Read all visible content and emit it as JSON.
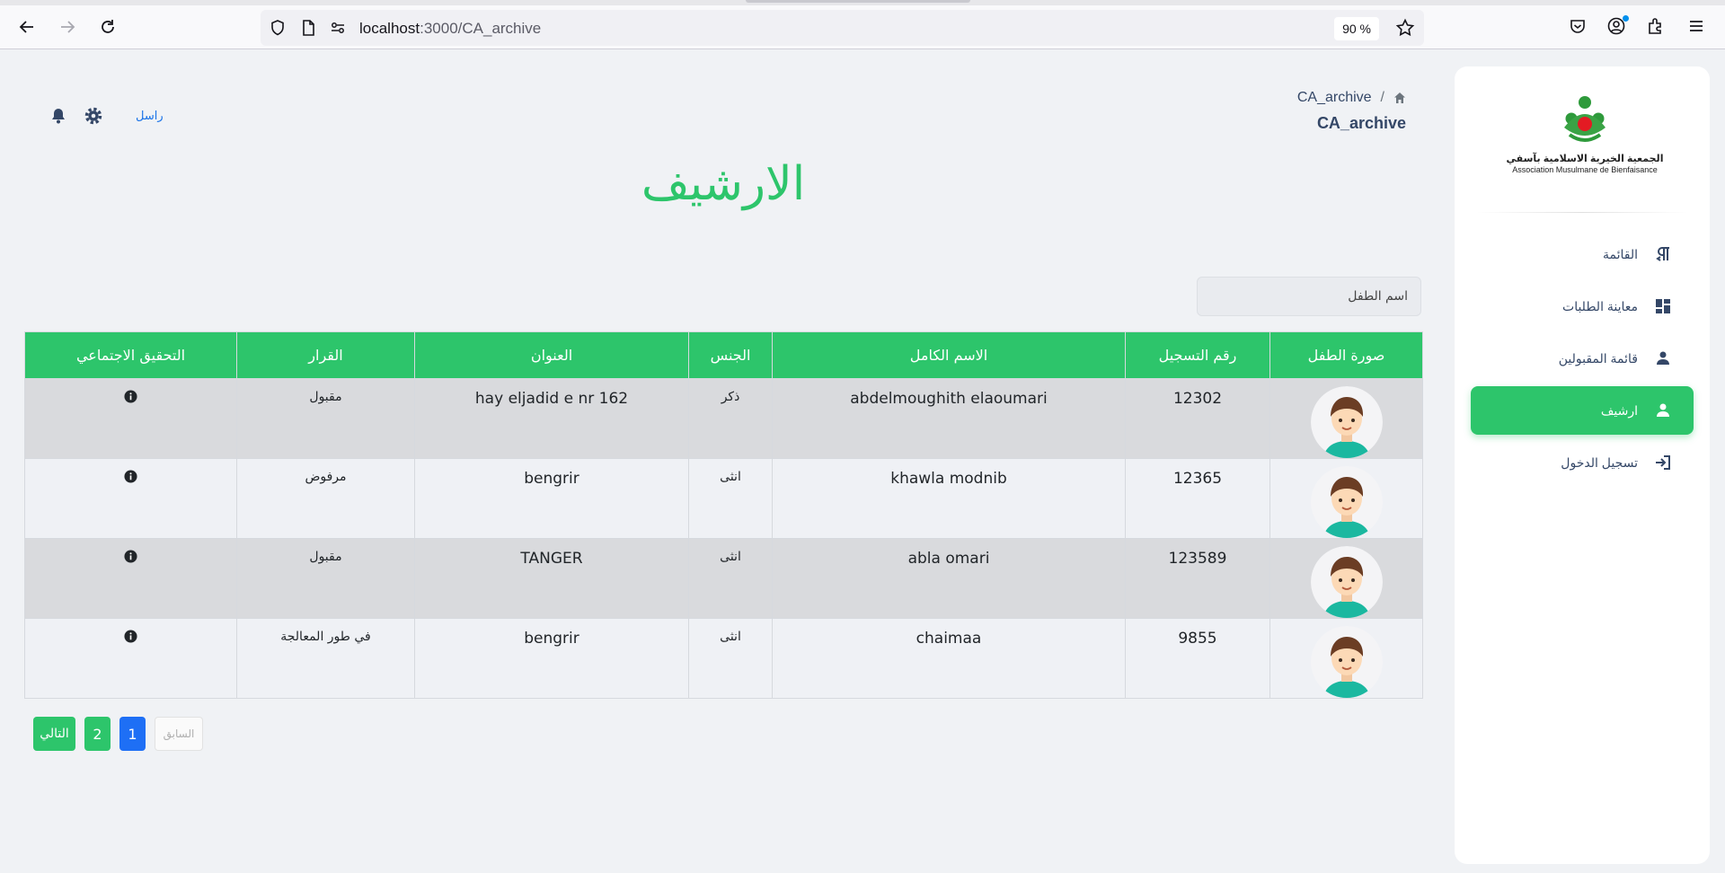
{
  "browser": {
    "url_host": "localhost",
    "url_path": ":3000/CA_archive",
    "zoom": "90 %"
  },
  "sidebar": {
    "logo_caption_ar": "الجمعية الخيرية الاسلامية بآسفي",
    "logo_caption_fr": "Association Musulmane de Bienfaisance",
    "items": [
      {
        "label": "القائمة",
        "icon": "pilcrow-icon",
        "active": false
      },
      {
        "label": "معاينة الطلبات",
        "icon": "dashboard-icon",
        "active": false
      },
      {
        "label": "قائمة المقبولين",
        "icon": "person-icon",
        "active": false
      },
      {
        "label": "ارشيف",
        "icon": "person-icon",
        "active": true
      },
      {
        "label": "تسجيل الدخول",
        "icon": "login-icon",
        "active": false
      }
    ]
  },
  "header": {
    "breadcrumb_current": "CA_archive",
    "subtitle": "CA_archive",
    "contact_link": "راسل"
  },
  "page": {
    "title": "الارشيف",
    "search_placeholder": "اسم الطفل"
  },
  "table": {
    "headers": [
      "صورة الطفل",
      "رقم التسجيل",
      "الاسم الكامل",
      "الجنس",
      "العنوان",
      "القرار",
      "التحقيق الاجتماعي"
    ],
    "rows": [
      {
        "reg": "12302",
        "name": "abdelmoughith elaoumari",
        "gender": "ذكر",
        "address": "hay eljadid e nr 162",
        "decision": "مقبول"
      },
      {
        "reg": "12365",
        "name": "khawla modnib",
        "gender": "انثى",
        "address": "bengrir",
        "decision": "مرفوض"
      },
      {
        "reg": "123589",
        "name": "abla omari",
        "gender": "انثى",
        "address": "TANGER",
        "decision": "مقبول"
      },
      {
        "reg": "9855",
        "name": "chaimaa",
        "gender": "انثى",
        "address": "bengrir",
        "decision": "في طور المعالجة"
      }
    ]
  },
  "pagination": {
    "next": "التالي",
    "page2": "2",
    "page1": "1",
    "prev": "السابق",
    "current_page": 1
  },
  "colors": {
    "accent": "#2dc56b",
    "active_page": "#1e6ff5",
    "background": "#f0f2f5"
  }
}
